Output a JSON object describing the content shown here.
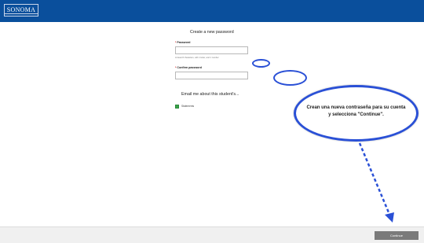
{
  "header": {
    "logo_text": "SONOMA",
    "bar_color": "#0a4f9c"
  },
  "form": {
    "title": "Create a new password",
    "password_label": "Password",
    "password_value": "",
    "password_hint": "At least 8 characters, with 1 letter, and 1 number",
    "confirm_label": "Confirm password",
    "confirm_value": "",
    "required_marker": "*"
  },
  "email_section": {
    "heading": "Email me about this student's...",
    "options": [
      {
        "label": "Statements",
        "checked": true
      }
    ]
  },
  "annotation": {
    "callout_text": "Crean una nueva contraseña para su cuenta y selecciona \"Continue\".",
    "color": "#2a50d6"
  },
  "footer": {
    "continue_label": "Continue"
  }
}
